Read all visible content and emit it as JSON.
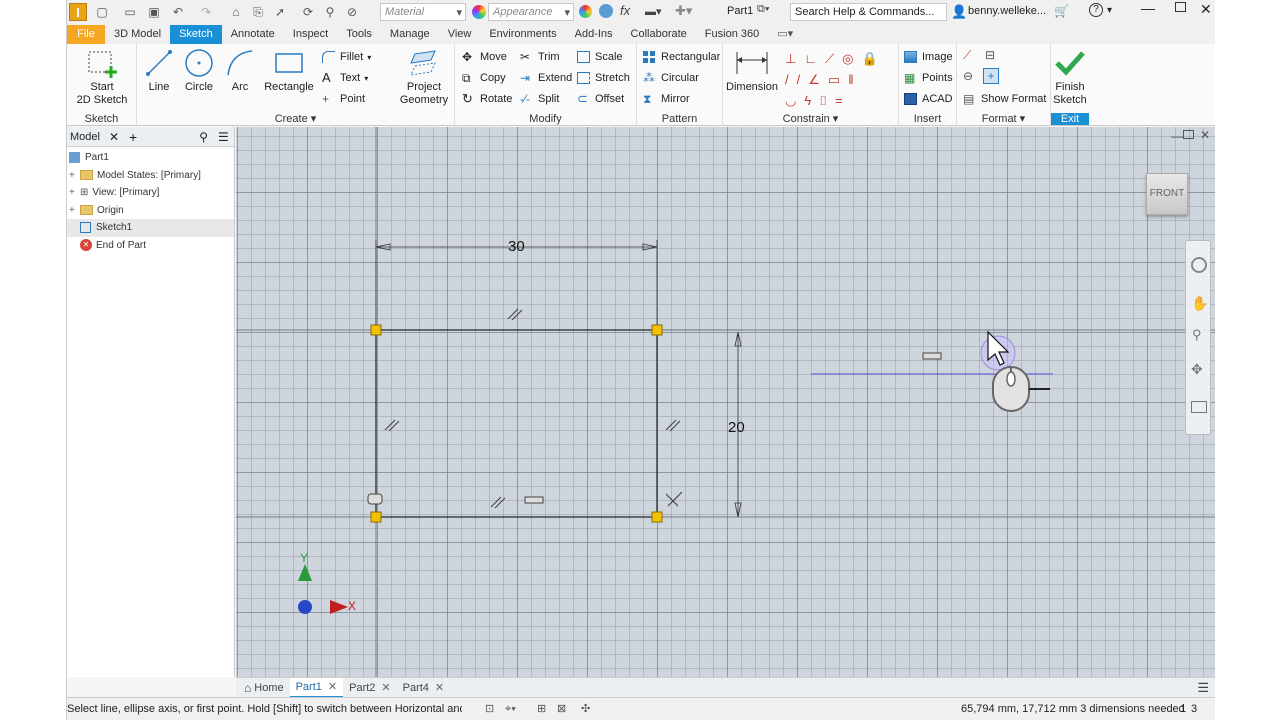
{
  "qat": {
    "material_placeholder": "Material",
    "appearance_placeholder": "Appearance",
    "doc_title": "Part1",
    "search_placeholder": "Search Help & Commands...",
    "user": "benny.welleke..."
  },
  "tabs": [
    "File",
    "3D Model",
    "Sketch",
    "Annotate",
    "Inspect",
    "Tools",
    "Manage",
    "View",
    "Environments",
    "Add-Ins",
    "Collaborate",
    "Fusion 360"
  ],
  "ribbon": {
    "sketch_group": {
      "label": "Sketch",
      "start": "Start",
      "start2": "2D Sketch"
    },
    "create_group": {
      "label": "Create",
      "line": "Line",
      "circle": "Circle",
      "arc": "Arc",
      "rectangle": "Rectangle",
      "fillet": "Fillet",
      "text": "Text",
      "point": "Point",
      "project": "Project",
      "project2": "Geometry"
    },
    "modify_group": {
      "label": "Modify",
      "move": "Move",
      "trim": "Trim",
      "scale": "Scale",
      "copy": "Copy",
      "extend": "Extend",
      "stretch": "Stretch",
      "rotate": "Rotate",
      "split": "Split",
      "offset": "Offset"
    },
    "pattern_group": {
      "label": "Pattern",
      "rectangular": "Rectangular",
      "circular": "Circular",
      "mirror": "Mirror"
    },
    "constrain_group": {
      "label": "Constrain",
      "dimension": "Dimension"
    },
    "insert_group": {
      "label": "Insert",
      "image": "Image",
      "points": "Points",
      "acad": "ACAD"
    },
    "format_group": {
      "label": "Format",
      "show_format": "Show Format"
    },
    "exit_group": {
      "label": "Exit",
      "finish": "Finish",
      "finish2": "Sketch"
    }
  },
  "browser": {
    "tab": "Model",
    "items": [
      {
        "label": "Part1"
      },
      {
        "label": "Model States: [Primary]"
      },
      {
        "label": "View: [Primary]"
      },
      {
        "label": "Origin"
      },
      {
        "label": "Sketch1"
      },
      {
        "label": "End of Part"
      }
    ]
  },
  "canvas": {
    "dim_width": "30",
    "dim_height": "20",
    "viewcube": "FRONT",
    "axis_y": "Y",
    "axis_x": "X"
  },
  "doc_tabs": [
    "Home",
    "Part1",
    "Part2",
    "Part4"
  ],
  "status": {
    "prompt": "Select line, ellipse axis, or first point. Hold [Shift] to switch between Horizontal and ...",
    "coords": "65,794 mm, 17,712 mm 3 dimensions needed",
    "n1": "1",
    "n2": "3"
  },
  "colors": {
    "accent": "#1a8fd6",
    "file_tab": "#f5a623",
    "finish_green": "#2fa84f",
    "point_yellow": "#f2c100"
  }
}
